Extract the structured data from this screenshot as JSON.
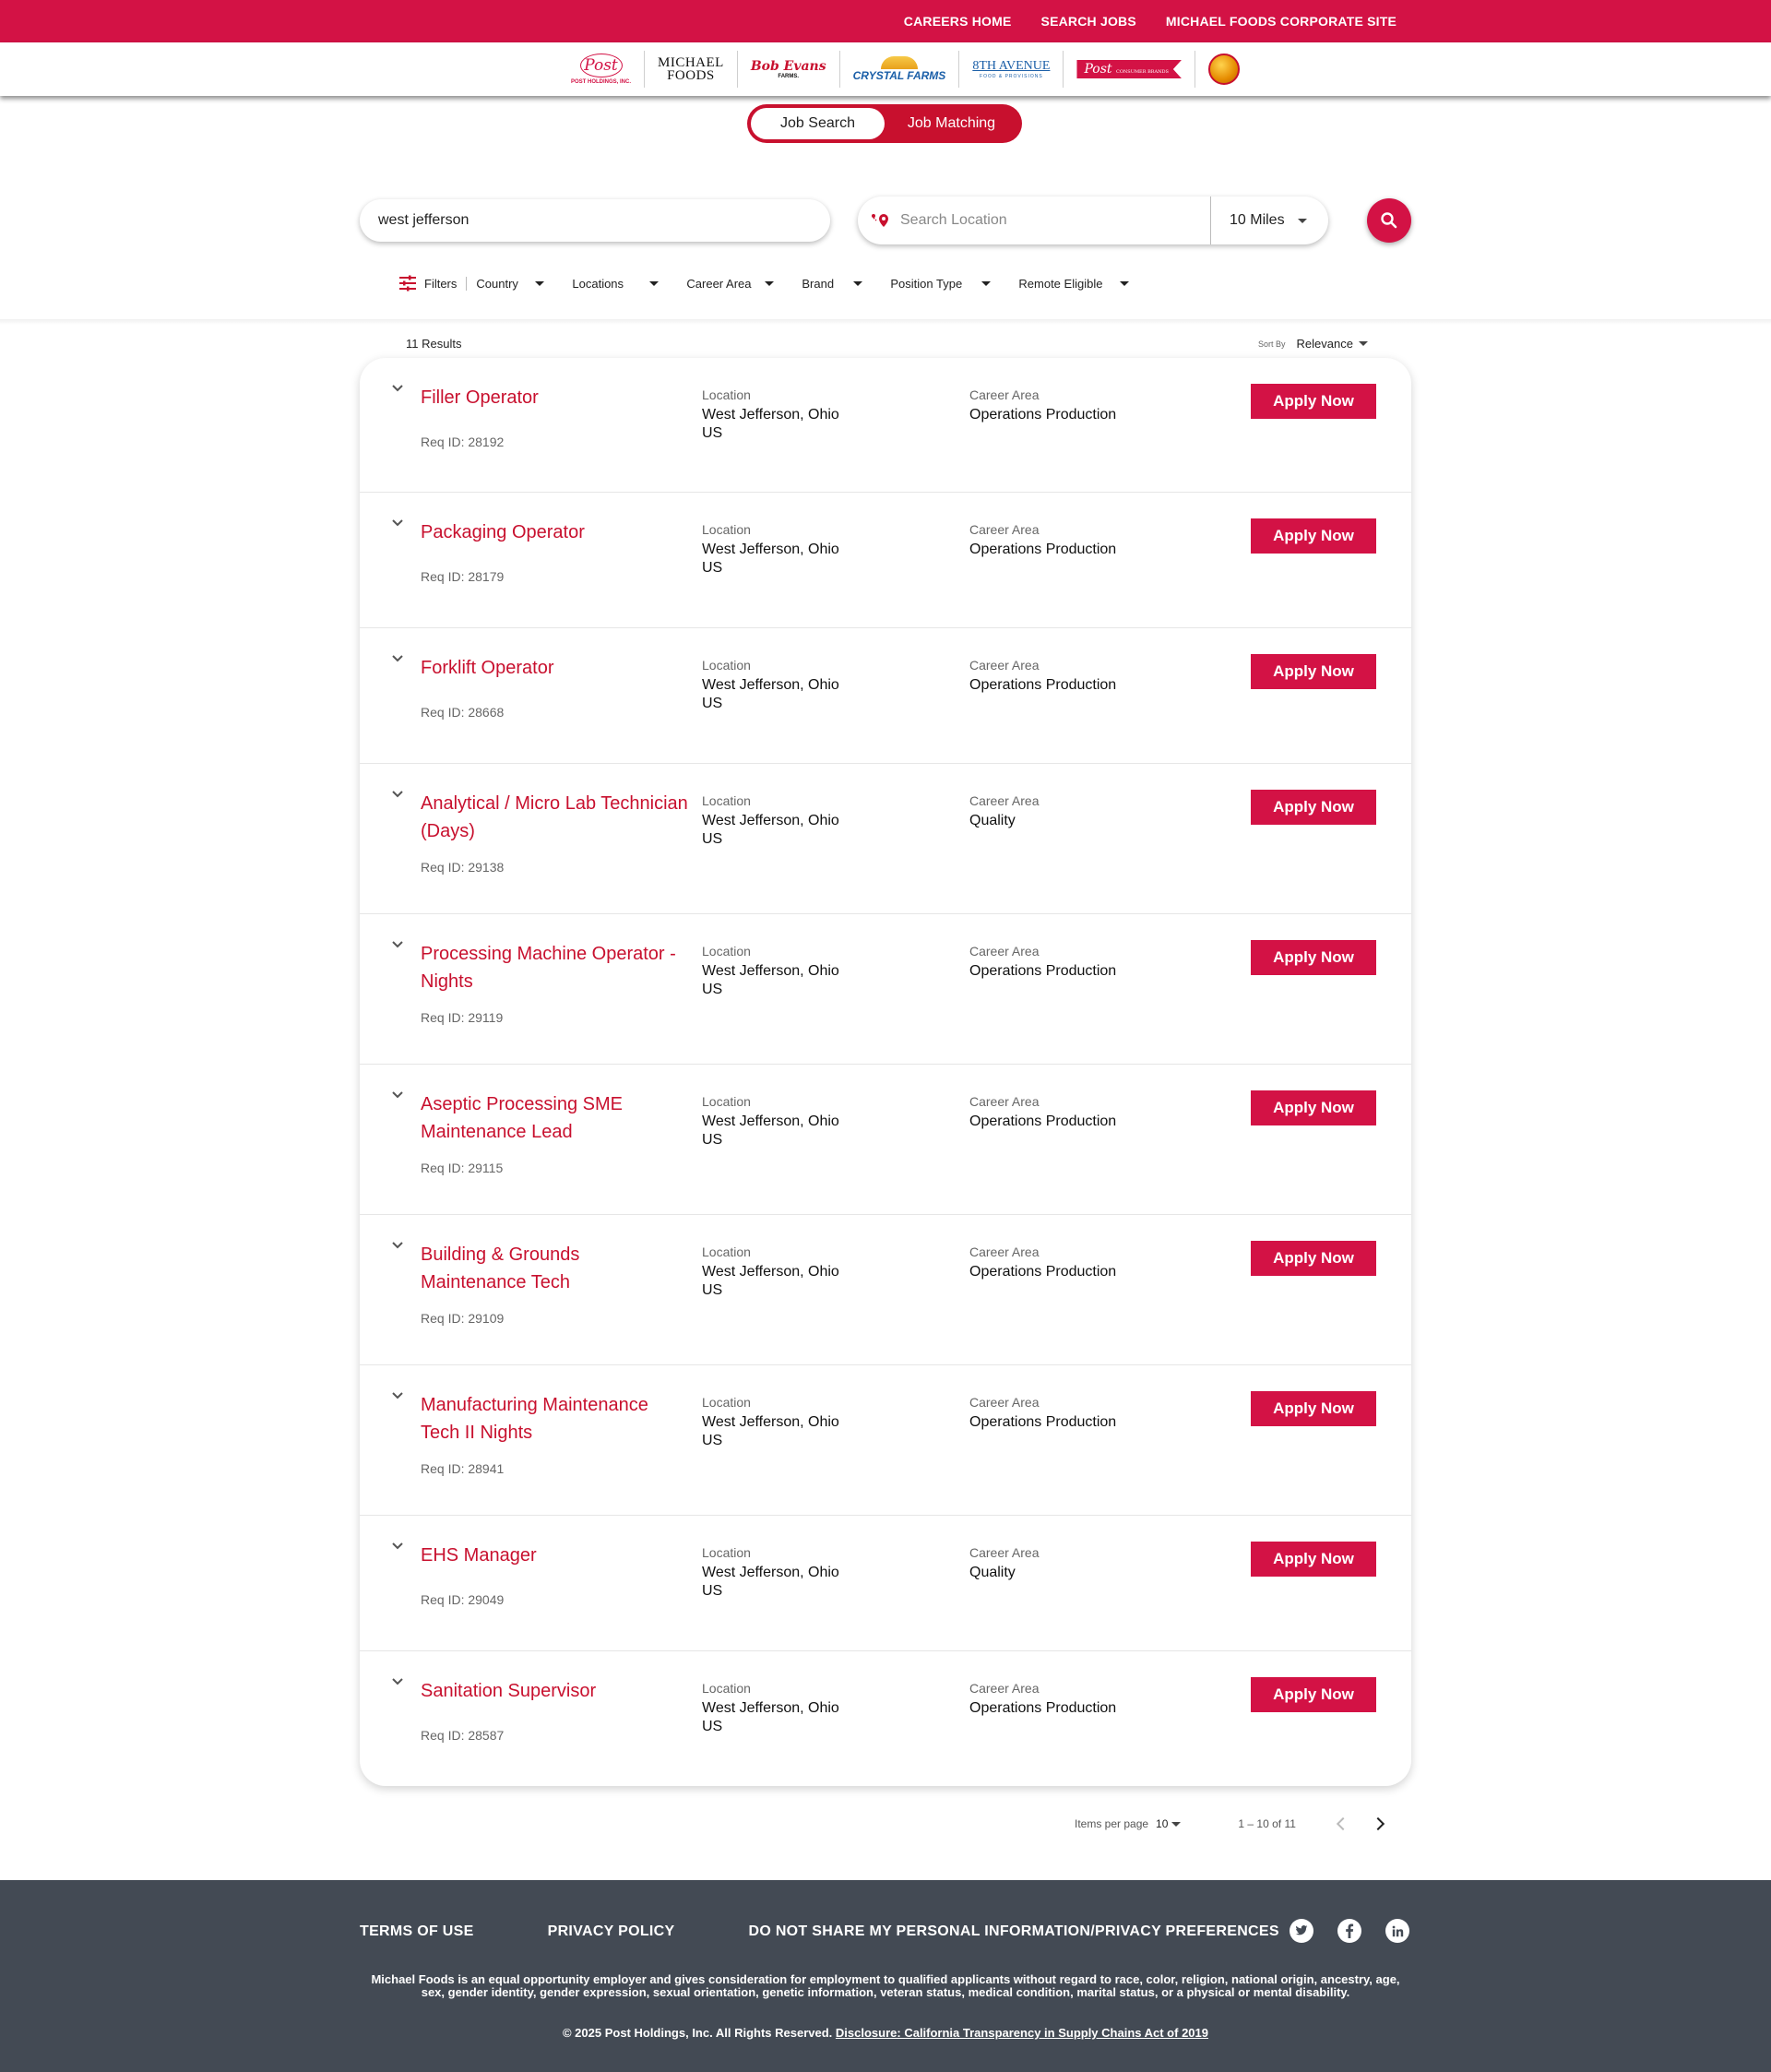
{
  "topnav": {
    "careers_home": "CAREERS HOME",
    "search_jobs": "SEARCH JOBS",
    "corporate_site": "MICHAEL FOODS CORPORATE SITE"
  },
  "brands": {
    "post": "Post",
    "post_sub": "POST HOLDINGS, INC.",
    "michael_foods_line1": "MICHAEL",
    "michael_foods_line2": "FOODS",
    "bob_evans": "Bob Evans",
    "bob_evans_sub": "FARMS.",
    "crystal_farms": "CRYSTAL FARMS",
    "eighth_avenue": "8TH AVENUE",
    "eighth_avenue_sub": "FOOD & PROVISIONS",
    "post_consumer": "Post",
    "post_consumer_sub": "CONSUMER BRANDS"
  },
  "mode_toggle": {
    "job_search": "Job Search",
    "job_matching": "Job Matching",
    "active": "Job Search"
  },
  "search": {
    "keyword_value": "west jefferson",
    "location_placeholder": "Search Location",
    "radius_value": "10 Miles"
  },
  "filters": {
    "label": "Filters",
    "items": [
      "Country",
      "Locations",
      "Career Area",
      "Brand",
      "Position Type",
      "Remote Eligible"
    ]
  },
  "results": {
    "count_label": "11 Results",
    "sort_label": "Sort By",
    "sort_value": "Relevance",
    "location_label": "Location",
    "career_area_label": "Career Area",
    "apply_label": "Apply Now",
    "jobs": [
      {
        "title": "Filler Operator",
        "req": "Req ID: 28192",
        "location": "West Jefferson, Ohio",
        "country": "US",
        "career_area": "Operations Production"
      },
      {
        "title": "Packaging Operator",
        "req": "Req ID: 28179",
        "location": "West Jefferson, Ohio",
        "country": "US",
        "career_area": "Operations Production"
      },
      {
        "title": "Forklift Operator",
        "req": "Req ID: 28668",
        "location": "West Jefferson, Ohio",
        "country": "US",
        "career_area": "Operations Production"
      },
      {
        "title": "Analytical / Micro Lab Technician (Days)",
        "req": "Req ID: 29138",
        "location": "West Jefferson, Ohio",
        "country": "US",
        "career_area": "Quality"
      },
      {
        "title": "Processing Machine Operator - Nights",
        "req": "Req ID: 29119",
        "location": "West Jefferson, Ohio",
        "country": "US",
        "career_area": "Operations Production"
      },
      {
        "title": "Aseptic Processing SME Maintenance Lead",
        "req": "Req ID: 29115",
        "location": "West Jefferson, Ohio",
        "country": "US",
        "career_area": "Operations Production"
      },
      {
        "title": "Building & Grounds Maintenance Tech",
        "req": "Req ID: 29109",
        "location": "West Jefferson, Ohio",
        "country": "US",
        "career_area": "Operations Production"
      },
      {
        "title": "Manufacturing Maintenance Tech II Nights",
        "req": "Req ID: 28941",
        "location": "West Jefferson, Ohio",
        "country": "US",
        "career_area": "Operations Production"
      },
      {
        "title": "EHS Manager",
        "req": "Req ID: 29049",
        "location": "West Jefferson, Ohio",
        "country": "US",
        "career_area": "Quality"
      },
      {
        "title": "Sanitation Supervisor",
        "req": "Req ID: 28587",
        "location": "West Jefferson, Ohio",
        "country": "US",
        "career_area": "Operations Production"
      }
    ]
  },
  "pagination": {
    "items_per_page_label": "Items per page",
    "items_per_page_value": "10",
    "range": "1 – 10 of 11"
  },
  "footer": {
    "terms": "TERMS OF USE",
    "privacy": "PRIVACY POLICY",
    "do_not_share": "DO NOT SHARE MY PERSONAL INFORMATION/PRIVACY PREFERENCES",
    "eeo": "Michael Foods is an equal opportunity employer and gives consideration for employment to qualified applicants without regard to race, color, religion, national origin, ancestry, age, sex, gender identity, gender expression, sexual orientation, genetic information, veteran status, medical condition, marital status, or a physical or mental disability.",
    "copyright": "© 2025 Post Holdings, Inc. All Rights Reserved.",
    "disclosure": "Disclosure: California Transparency in Supply Chains Act of 2019",
    "social_icons": [
      "twitter-icon",
      "facebook-icon",
      "linkedin-icon"
    ]
  },
  "colors": {
    "brand_red": "#d31245",
    "footer_bg": "#434a54"
  }
}
